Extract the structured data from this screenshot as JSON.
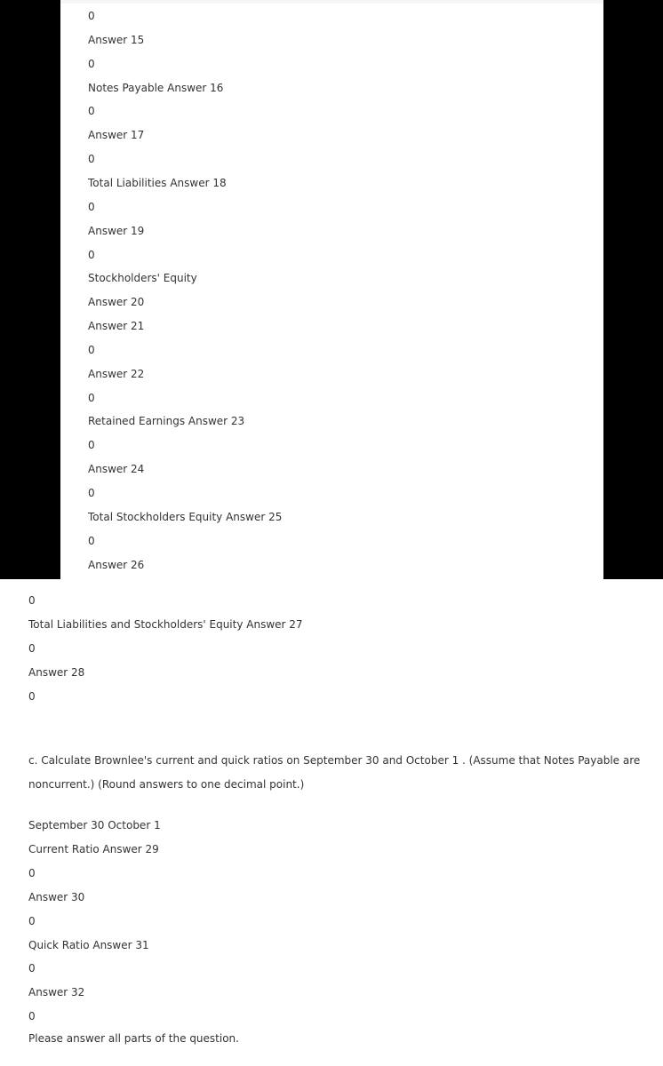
{
  "inner_lines": [
    {
      "text": "0",
      "type": "value"
    },
    {
      "text": "Answer 15",
      "type": "label"
    },
    {
      "text": "0",
      "type": "value"
    },
    {
      "text": "Notes Payable Answer 16",
      "type": "label"
    },
    {
      "text": "0",
      "type": "value"
    },
    {
      "text": "Answer 17",
      "type": "label"
    },
    {
      "text": "0",
      "type": "value"
    },
    {
      "text": "Total Liabilities Answer 18",
      "type": "label"
    },
    {
      "text": "0",
      "type": "value"
    },
    {
      "text": "Answer 19",
      "type": "label"
    },
    {
      "text": "0",
      "type": "value"
    },
    {
      "text": "Stockholders' Equity",
      "type": "heading"
    },
    {
      "text": "Answer 20",
      "type": "label"
    },
    {
      "text": "Answer 21",
      "type": "label"
    },
    {
      "text": "0",
      "type": "value"
    },
    {
      "text": "Answer 22",
      "type": "label"
    },
    {
      "text": "0",
      "type": "value"
    },
    {
      "text": "Retained Earnings Answer 23",
      "type": "label"
    },
    {
      "text": "0",
      "type": "value"
    },
    {
      "text": "Answer 24",
      "type": "label"
    },
    {
      "text": "0",
      "type": "value"
    },
    {
      "text": "Total Stockholders Equity Answer 25",
      "type": "label"
    },
    {
      "text": "0",
      "type": "value"
    },
    {
      "text": "Answer 26",
      "type": "label"
    }
  ],
  "outer_lines": [
    {
      "text": "0",
      "type": "value"
    },
    {
      "text": "Total Liabilities and Stockholders' Equity Answer 27",
      "type": "label"
    },
    {
      "text": "0",
      "type": "value"
    },
    {
      "text": "Answer 28",
      "type": "label"
    },
    {
      "text": "0",
      "type": "value"
    }
  ],
  "question_c": {
    "line1": "c. Calculate Brownlee's current and quick ratios on September 30 and October 1 . (Assume that Notes Payable are",
    "line2": "noncurrent.) (Round answers to one decimal point.)"
  },
  "ratio_lines": [
    {
      "text": "September 30 October 1",
      "type": "heading"
    },
    {
      "text": "Current Ratio Answer 29",
      "type": "label"
    },
    {
      "text": "0",
      "type": "value"
    },
    {
      "text": "Answer 30",
      "type": "label"
    },
    {
      "text": "0",
      "type": "value"
    },
    {
      "text": "Quick Ratio Answer 31",
      "type": "label"
    },
    {
      "text": "0",
      "type": "value"
    },
    {
      "text": "Answer 32",
      "type": "label"
    },
    {
      "text": "0",
      "type": "value"
    }
  ],
  "footer_note": "Please answer all parts of the question."
}
